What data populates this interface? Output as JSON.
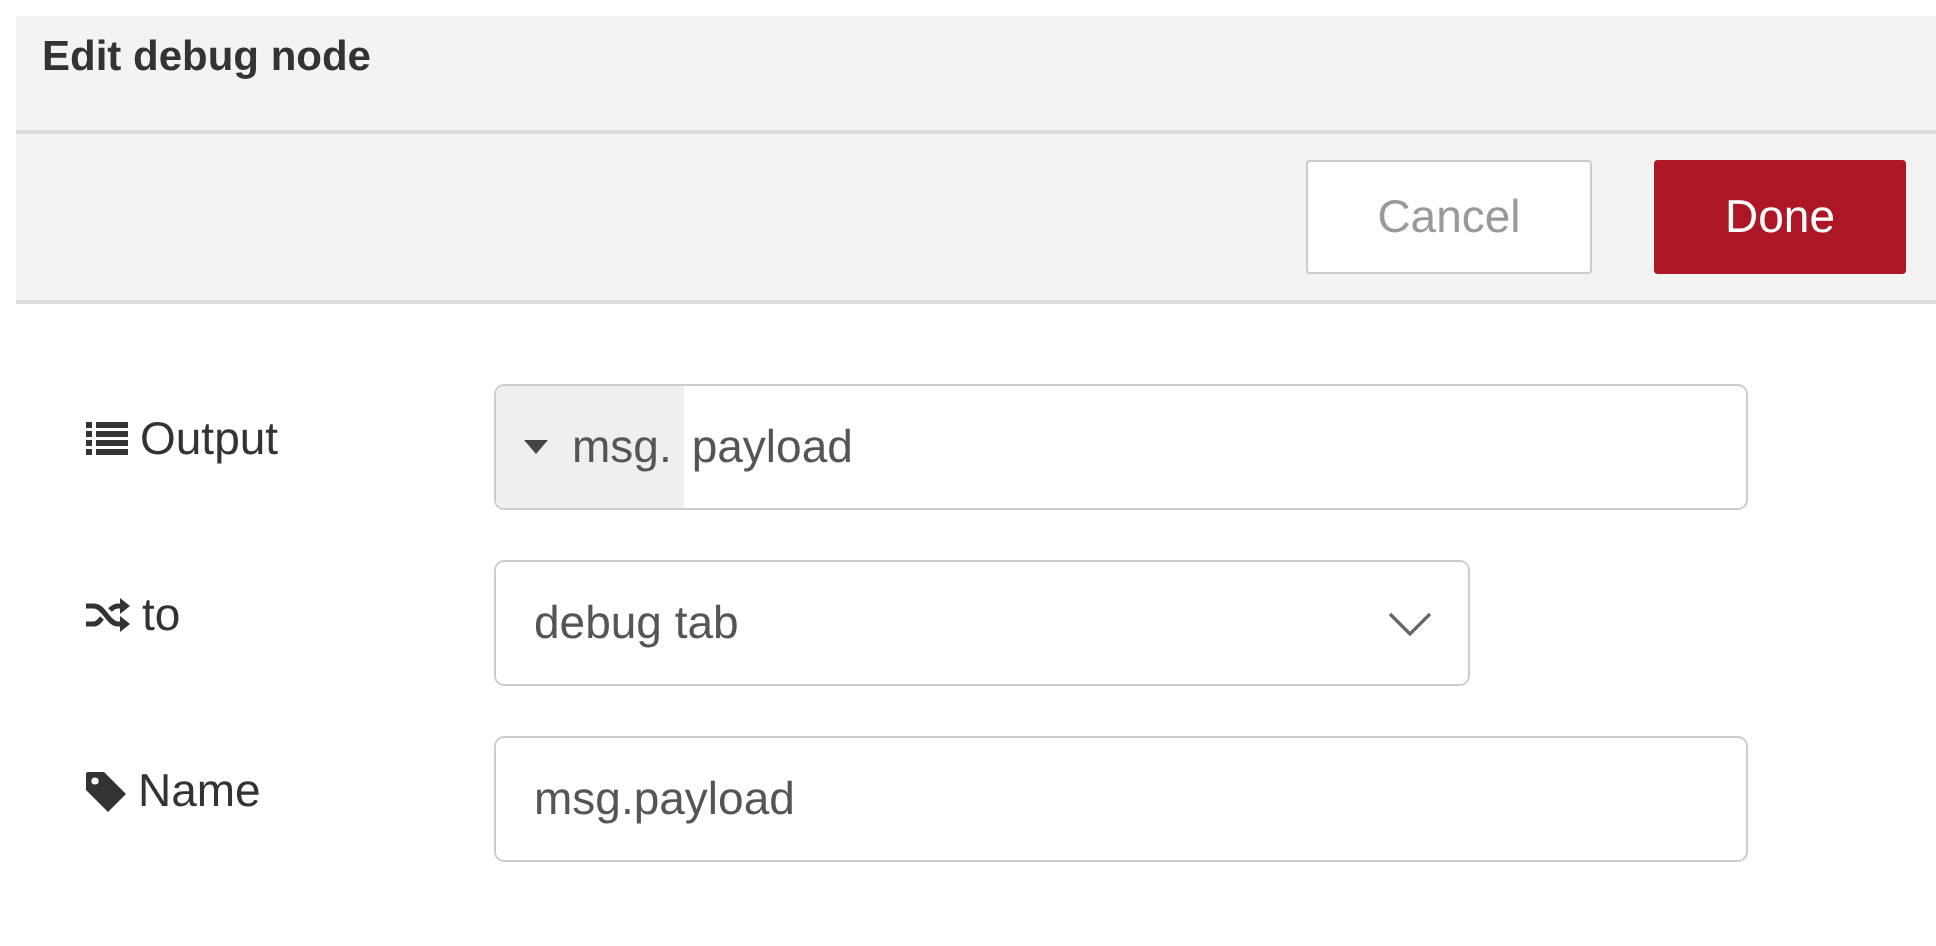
{
  "title": "Edit debug node",
  "buttons": [
    {
      "label": "Cancel",
      "kind": "secondary"
    },
    {
      "label": "Done",
      "kind": "primary"
    }
  ],
  "fields": [
    {
      "label": "Output",
      "kind": "typed",
      "type": "msg.",
      "value": "payload"
    },
    {
      "label": "to",
      "kind": "select",
      "value": "debug tab"
    },
    {
      "label": "Name",
      "kind": "text",
      "value": "msg.payload"
    }
  ]
}
